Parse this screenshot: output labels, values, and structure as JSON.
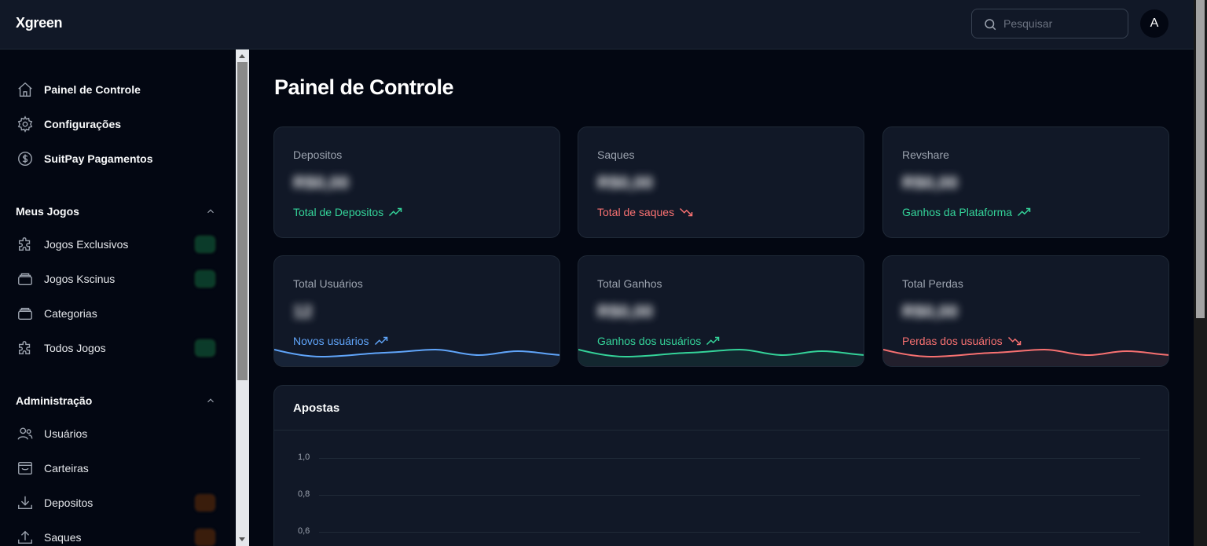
{
  "app": {
    "brand": "Xgreen"
  },
  "search": {
    "placeholder": "Pesquisar"
  },
  "user": {
    "avatar_letter": "A"
  },
  "sidebar": {
    "main_items": [
      {
        "label": "Painel de Controle",
        "icon": "home-icon"
      },
      {
        "label": "Configurações",
        "icon": "gear-icon"
      },
      {
        "label": "SuitPay Pagamentos",
        "icon": "dollar-circle-icon"
      }
    ],
    "sections": [
      {
        "title": "Meus Jogos",
        "items": [
          {
            "label": "Jogos Exclusivos",
            "icon": "puzzle-icon"
          },
          {
            "label": "Jogos Kscinus",
            "icon": "stack-icon"
          },
          {
            "label": "Categorias",
            "icon": "stack-icon"
          },
          {
            "label": "Todos Jogos",
            "icon": "puzzle-icon"
          }
        ]
      },
      {
        "title": "Administração",
        "items": [
          {
            "label": "Usuários",
            "icon": "users-icon"
          },
          {
            "label": "Carteiras",
            "icon": "wallet-icon"
          },
          {
            "label": "Depositos",
            "icon": "download-icon"
          },
          {
            "label": "Saques",
            "icon": "upload-icon"
          }
        ]
      }
    ]
  },
  "page": {
    "title": "Painel de Controle"
  },
  "cards": [
    {
      "title": "Depositos",
      "value": "R$0,00",
      "subtitle": "Total de Depositos",
      "trend": "up",
      "color": "#34d399"
    },
    {
      "title": "Saques",
      "value": "R$0,00",
      "subtitle": "Total de saques",
      "trend": "down",
      "color": "#f87171"
    },
    {
      "title": "Revshare",
      "value": "R$0,00",
      "subtitle": "Ganhos da Plataforma",
      "trend": "up",
      "color": "#34d399"
    },
    {
      "title": "Total Usuários",
      "value": "12",
      "subtitle": "Novos usuários",
      "trend": "up",
      "color": "#60a5fa"
    },
    {
      "title": "Total Ganhos",
      "value": "R$0,00",
      "subtitle": "Ganhos dos usuários",
      "trend": "up",
      "color": "#34d399"
    },
    {
      "title": "Total Perdas",
      "value": "R$0,00",
      "subtitle": "Perdas dos usuários",
      "trend": "down",
      "color": "#f87171"
    }
  ],
  "apostas": {
    "title": "Apostas",
    "y_ticks": [
      "1,0",
      "0,8",
      "0,6"
    ]
  }
}
